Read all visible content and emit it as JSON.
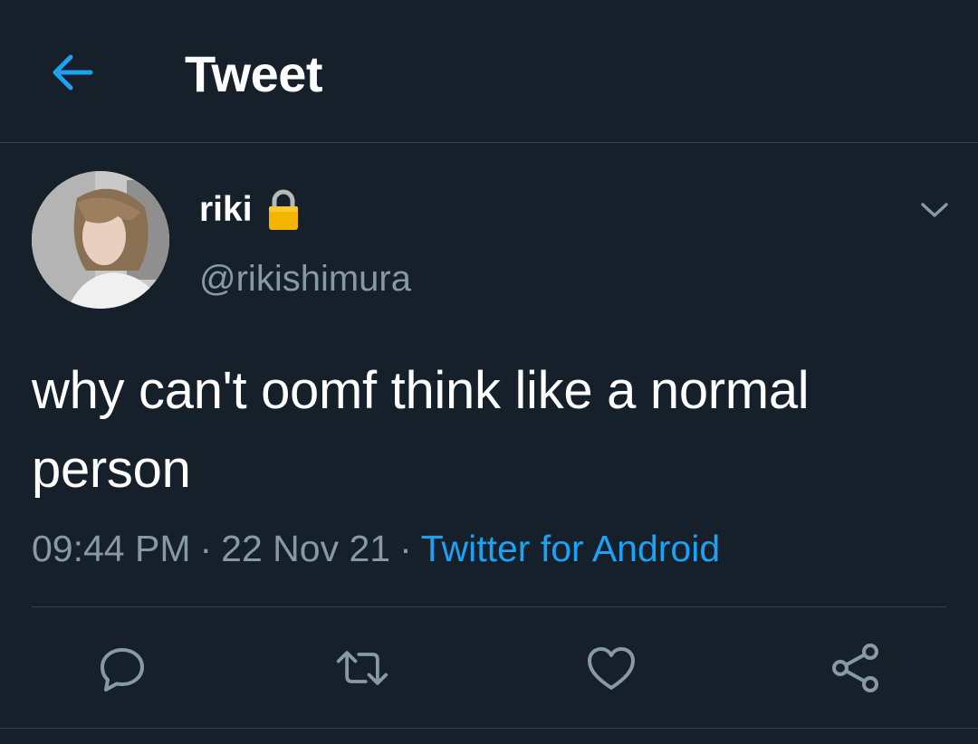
{
  "header": {
    "title": "Tweet",
    "back_icon": "back-arrow-icon"
  },
  "colors": {
    "background": "#15202b",
    "accent": "#1da1f2",
    "secondary_text": "#8899a6",
    "divider": "#38444d"
  },
  "tweet": {
    "author": {
      "display_name": "riki",
      "handle": "@rikishimura",
      "protected_icon": "lock-icon"
    },
    "text": "why can't oomf think like a normal person",
    "time": "09:44 PM",
    "date": "22 Nov 21",
    "separator": "·",
    "source": "Twitter for Android",
    "actions": [
      {
        "name": "reply",
        "icon": "reply-icon"
      },
      {
        "name": "retweet",
        "icon": "retweet-icon"
      },
      {
        "name": "like",
        "icon": "heart-icon"
      },
      {
        "name": "share",
        "icon": "share-icon"
      }
    ]
  }
}
